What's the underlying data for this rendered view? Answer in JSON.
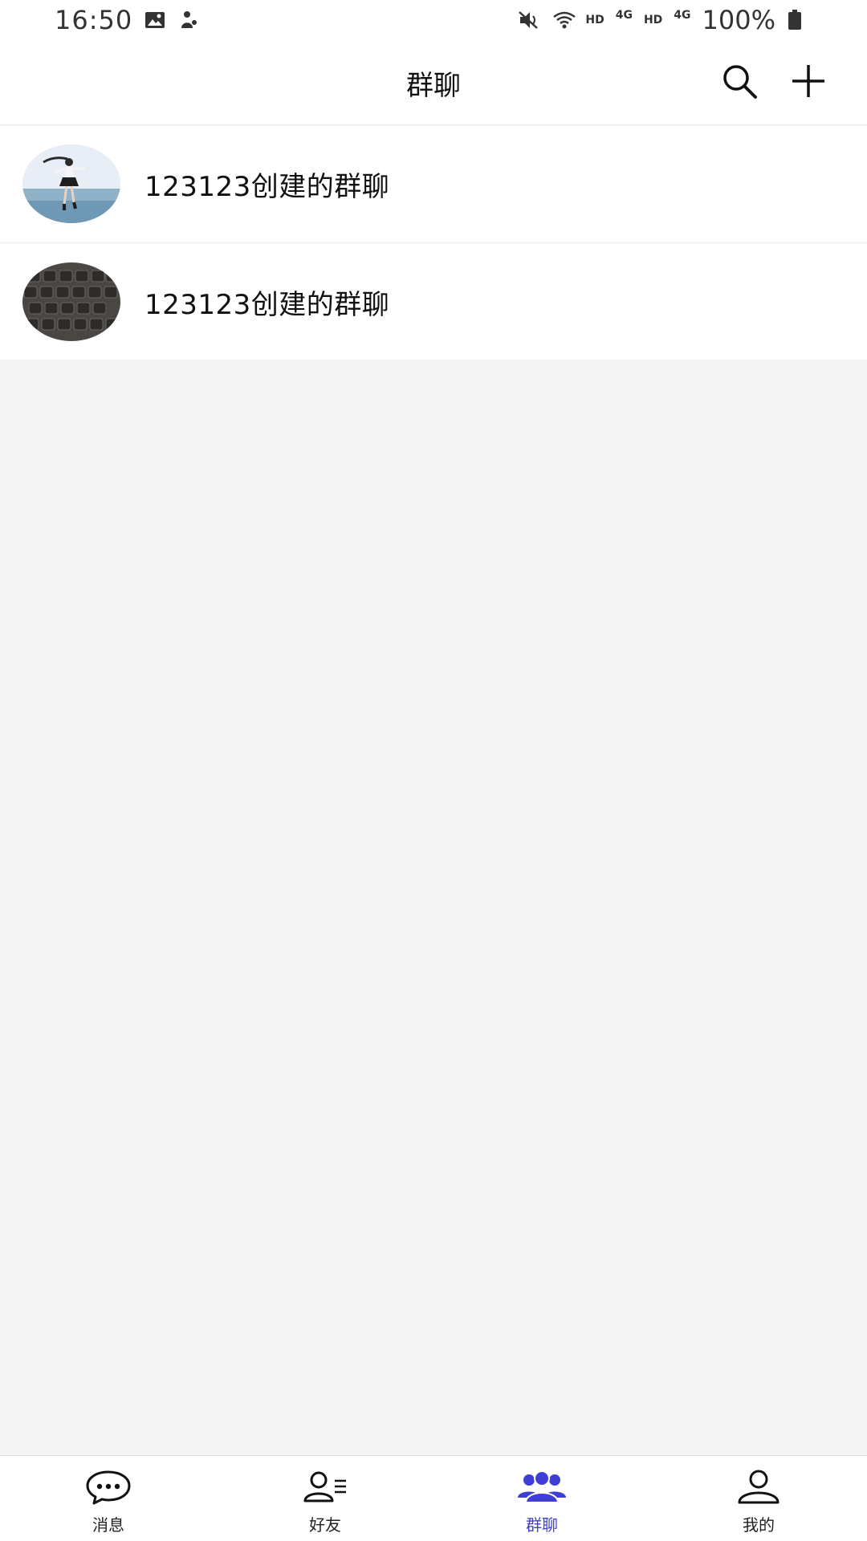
{
  "status_bar": {
    "time": "16:50",
    "network_label_1": "HD",
    "signal_label_1": "4G",
    "network_label_2": "HD",
    "signal_label_2": "4G",
    "battery": "100%",
    "icons": [
      "image-icon",
      "app-notification-icon",
      "mute-icon",
      "wifi-icon",
      "battery-icon"
    ]
  },
  "header": {
    "title": "群聊",
    "icons": [
      "search-icon",
      "plus-icon"
    ]
  },
  "groups": [
    {
      "name": "123123创建的群聊",
      "avatar": "photo-girl-beach"
    },
    {
      "name": "123123创建的群聊",
      "avatar": "photo-keyboard"
    }
  ],
  "bottom_nav": {
    "active": "群聊",
    "accent_color": "#3f3fd6",
    "items": [
      {
        "label": "消息",
        "icon": "chat-bubble-icon"
      },
      {
        "label": "好友",
        "icon": "friends-icon"
      },
      {
        "label": "群聊",
        "icon": "group-icon"
      },
      {
        "label": "我的",
        "icon": "profile-icon"
      }
    ]
  }
}
